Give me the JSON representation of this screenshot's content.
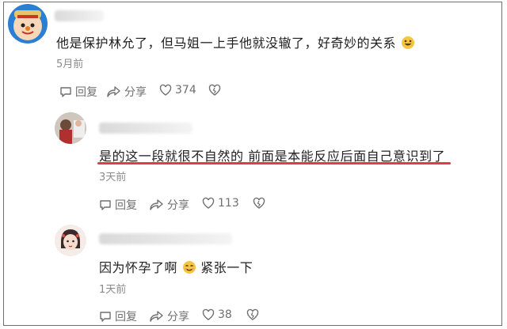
{
  "comments": [
    {
      "text": "他是保护林允了，但马姐一上手他就没辙了，好奇妙的关系",
      "time": "5月前",
      "actions": {
        "reply": "回复",
        "share": "分享",
        "likes": "374"
      }
    },
    {
      "text": "是的这一段就很不自然的 前面是本能反应后面自己意识到了",
      "time": "3天前",
      "actions": {
        "reply": "回复",
        "share": "分享",
        "likes": "113"
      }
    },
    {
      "text_part1": "因为怀孕了啊",
      "text_part2": "紧张一下",
      "time": "1天前",
      "actions": {
        "reply": "回复",
        "share": "分享",
        "likes": "38"
      }
    }
  ],
  "colors": {
    "highlight_underline": "#e23a4a",
    "meta_text": "#8a8a8a"
  },
  "icons": [
    "reply-icon",
    "share-icon",
    "like-icon",
    "dislike-icon",
    "emoji-grin-icon",
    "emoji-smile-icon"
  ]
}
